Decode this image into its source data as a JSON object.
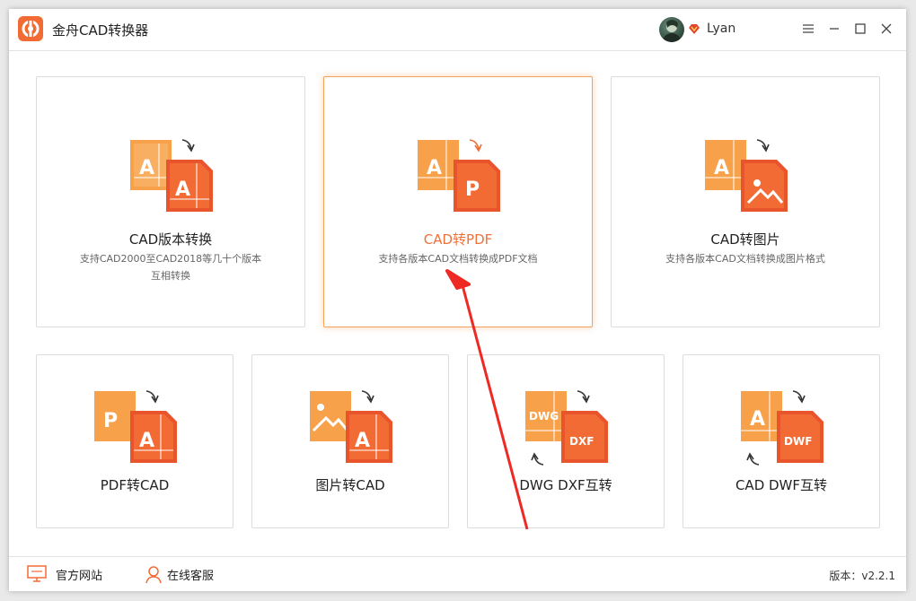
{
  "app": {
    "title": "金舟CAD转换器",
    "accent": "#f26b35"
  },
  "user": {
    "name": "Lyan"
  },
  "window_controls": {
    "menu_icon": "menu-icon",
    "minimize_icon": "minimize-icon",
    "maximize_icon": "maximize-icon",
    "close_icon": "close-icon"
  },
  "cards": [
    {
      "title": "CAD版本转换",
      "desc1": "支持CAD2000至CAD2018等几十个版本",
      "desc2": "互相转换",
      "icon": "cad-version-convert-icon"
    },
    {
      "title": "CAD转PDF",
      "desc1": "支持各版本CAD文档转换成PDF文档",
      "desc2": "",
      "icon": "cad-to-pdf-icon"
    },
    {
      "title": "CAD转图片",
      "desc1": "支持各版本CAD文档转换成图片格式",
      "desc2": "",
      "icon": "cad-to-image-icon"
    },
    {
      "title": "PDF转CAD",
      "icon": "pdf-to-cad-icon"
    },
    {
      "title": "图片转CAD",
      "icon": "image-to-cad-icon"
    },
    {
      "title": "DWG DXF互转",
      "icon": "dwg-dxf-convert-icon",
      "badge1": "DWG",
      "badge2": "DXF"
    },
    {
      "title": "CAD DWF互转",
      "icon": "cad-dwf-convert-icon",
      "badge": "DWF"
    }
  ],
  "footer": {
    "website": "官方网站",
    "support": "在线客服",
    "version": "版本：v2.2.1"
  }
}
